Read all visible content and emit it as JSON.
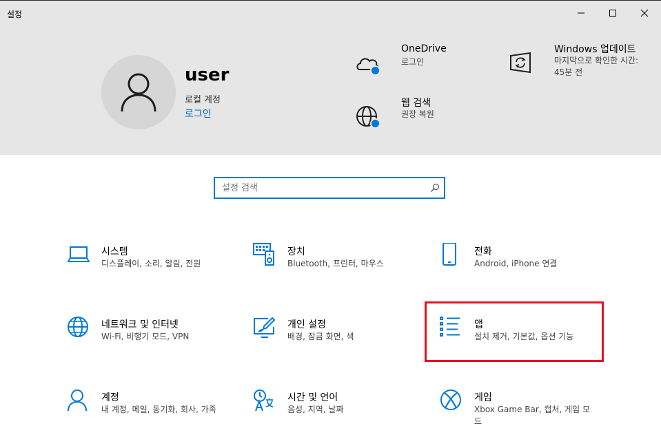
{
  "window": {
    "title": "설정"
  },
  "header": {
    "username": "user",
    "account_type": "로컬 계정",
    "signin_label": "로그인",
    "items": [
      {
        "title": "OneDrive",
        "subtitle": "로그인"
      },
      {
        "title": "웹 검색",
        "subtitle": "권장 복원"
      },
      {
        "title": "Windows 업데이트",
        "subtitle": "마지막으로 확인한 시간: 45분 전"
      }
    ]
  },
  "search": {
    "placeholder": "설정 검색",
    "value": ""
  },
  "tiles": [
    {
      "name": "시스템",
      "desc": "디스플레이, 소리, 알림, 전원"
    },
    {
      "name": "장치",
      "desc": "Bluetooth, 프린터, 마우스"
    },
    {
      "name": "전화",
      "desc": "Android, iPhone 연결"
    },
    {
      "name": "네트워크 및 인터넷",
      "desc": "Wi-Fi, 비행기 모드, VPN"
    },
    {
      "name": "개인 설정",
      "desc": "배경, 잠금 화면, 색"
    },
    {
      "name": "앱",
      "desc": "설치 제거, 기본값, 옵션 기능"
    },
    {
      "name": "계정",
      "desc": "내 계정, 메일, 동기화, 회사, 가족"
    },
    {
      "name": "시간 및 언어",
      "desc": "음성, 지역, 날짜"
    },
    {
      "name": "게임",
      "desc": "Xbox Game Bar, 캡처, 게임 모드"
    }
  ],
  "colors": {
    "accent": "#0078d4",
    "link": "#0067c0",
    "header_bg": "#e6e6e6",
    "highlight": "#e81123"
  }
}
